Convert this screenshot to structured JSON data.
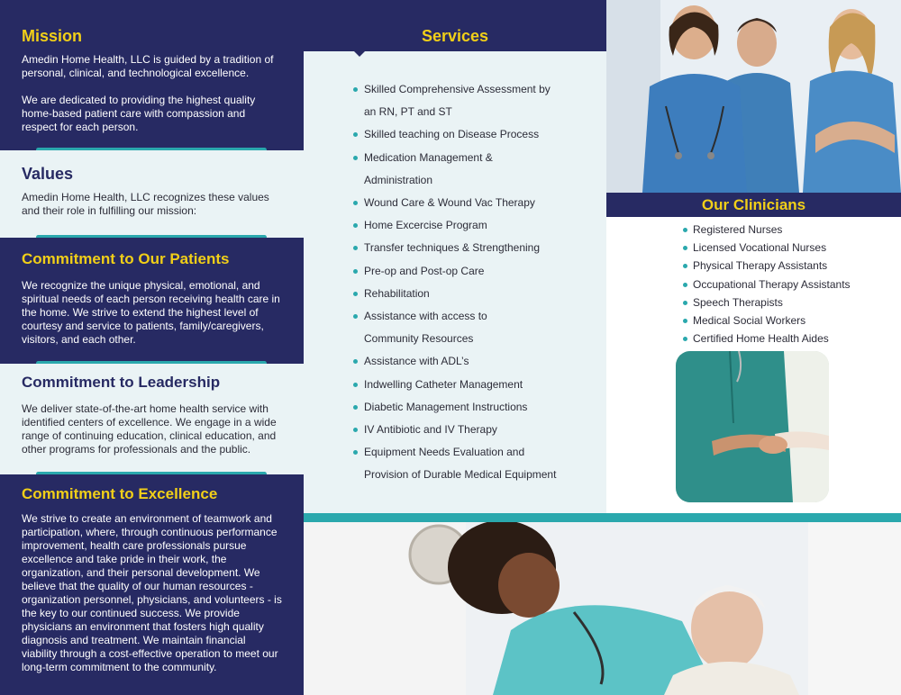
{
  "mission": {
    "title": "Mission",
    "p1": "Amedin Home Health, LLC is guided by a tradition of personal, clinical, and technological excellence.",
    "p2": "We are dedicated to providing the highest quality home-based patient care with compassion and respect for each person."
  },
  "values": {
    "title": "Values",
    "text": "Amedin Home Health, LLC recognizes these values and their role in fulfilling our mission:"
  },
  "patients": {
    "title": "Commitment to Our Patients",
    "text": "We recognize the unique physical, emotional, and spiritual needs of each person receiving health care in the home. We strive to extend the highest level of courtesy and service to patients, family/caregivers, visitors, and each other."
  },
  "leadership": {
    "title": "Commitment to Leadership",
    "text": "We deliver state-of-the-art home health service with identified centers of excellence. We engage in a wide range of continuing education, clinical education, and other programs for professionals and the public."
  },
  "excellence": {
    "title": "Commitment to Excellence",
    "text": "We strive to create an environment of teamwork and participation, where, through continuous performance improvement, health care professionals pursue excellence and take pride in their work, the organization, and their personal development. We believe that the quality of our human resources - organization personnel, physicians, and volunteers - is the key to our continued success. We provide physicians an environment that fosters high quality diagnosis and treatment. We maintain financial viability through a cost-effective operation to meet our long-term commitment to the community."
  },
  "services": {
    "title": "Services",
    "items": [
      [
        "Skilled Comprehensive Assessment by",
        "an RN, PT and ST"
      ],
      [
        "Skilled teaching on Disease Process"
      ],
      [
        "Medication Management &",
        "Administration"
      ],
      [
        "Wound Care & Wound Vac Therapy"
      ],
      [
        "Home Excercise Program"
      ],
      [
        "Transfer techniques & Strengthening"
      ],
      [
        "Pre-op and Post-op Care"
      ],
      [
        "Rehabilitation"
      ],
      [
        "Assistance with access to",
        "Community Resources"
      ],
      [
        "Assistance with ADL’s"
      ],
      [
        "Indwelling Catheter Management"
      ],
      [
        "Diabetic Management Instructions"
      ],
      [
        "IV Antibiotic and IV Therapy"
      ],
      [
        "Equipment Needs Evaluation and",
        "Provision of Durable Medical Equipment"
      ]
    ]
  },
  "clinicians": {
    "title": "Our Clinicians",
    "items": [
      "Registered Nurses",
      "Licensed Vocational Nurses",
      "Physical Therapy Assistants",
      "Occupational Therapy Assistants",
      "Speech Therapists",
      "Medical Social Workers",
      "Certified Home Health Aides"
    ]
  },
  "colors": {
    "navy": "#272a63",
    "yellow": "#f1cf18",
    "teal": "#2aa8ad",
    "light": "#eaf3f5"
  }
}
